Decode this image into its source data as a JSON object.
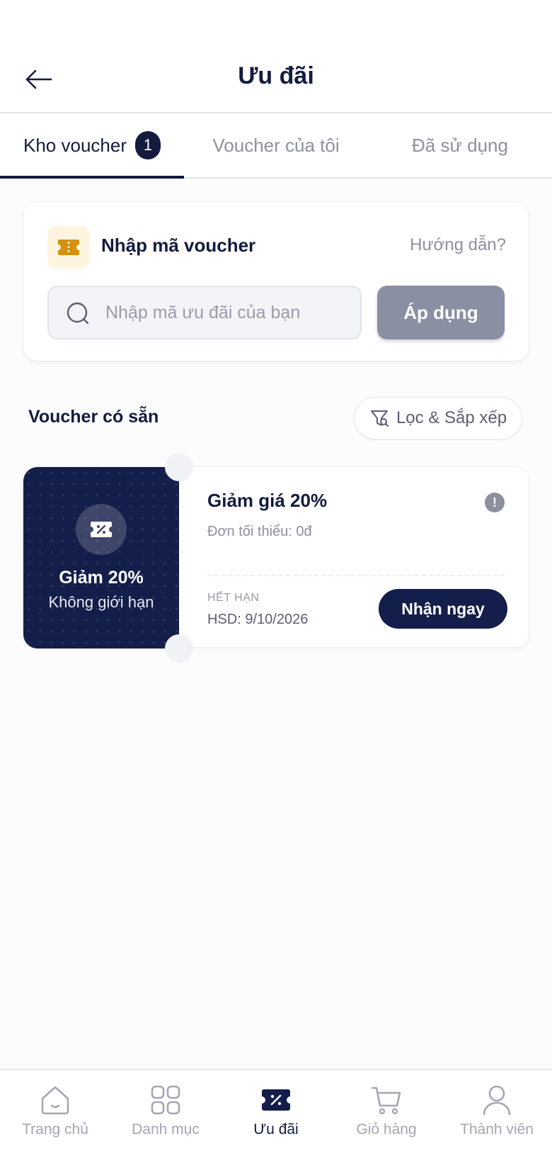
{
  "header": {
    "title": "Ưu đãi",
    "back_icon": "arrow-left-icon"
  },
  "tabs": [
    {
      "label": "Kho voucher",
      "badge": "1",
      "active": true
    },
    {
      "label": "Voucher của tôi",
      "active": false
    },
    {
      "label": "Đã sử dụng",
      "active": false
    }
  ],
  "code_card": {
    "title": "Nhập mã voucher",
    "guide_link": "Hướng dẫn?",
    "input_placeholder": "Nhập mã ưu đãi của bạn",
    "input_value": "",
    "apply_label": "Áp dụng",
    "icon": "ticket-icon"
  },
  "section": {
    "title": "Voucher có sẵn",
    "filter_label": "Lọc & Sắp xếp",
    "filter_icon": "filter-icon"
  },
  "vouchers": [
    {
      "left_title": "Giảm 20%",
      "left_subtitle": "Không giới hạn",
      "name": "Giảm giá 20%",
      "min_order": "Đơn tối thiểu: 0đ",
      "expire_label": "HẾT HẠN",
      "expire_date": "HSD: 9/10/2026",
      "claim_label": "Nhận ngay",
      "info_symbol": "!"
    }
  ],
  "bottom_nav": [
    {
      "label": "Trang chủ",
      "icon": "home-icon",
      "active": false
    },
    {
      "label": "Danh mục",
      "icon": "grid-icon",
      "active": false
    },
    {
      "label": "Ưu đãi",
      "icon": "discount-ticket-icon",
      "active": true
    },
    {
      "label": "Giỏ hàng",
      "icon": "cart-icon",
      "active": false
    },
    {
      "label": "Thành viên",
      "icon": "user-icon",
      "active": false
    }
  ],
  "colors": {
    "primary": "#141e4a",
    "accent_yellow": "#d4910f",
    "muted": "#8d909f",
    "apply_button": "#8a8fa3"
  }
}
